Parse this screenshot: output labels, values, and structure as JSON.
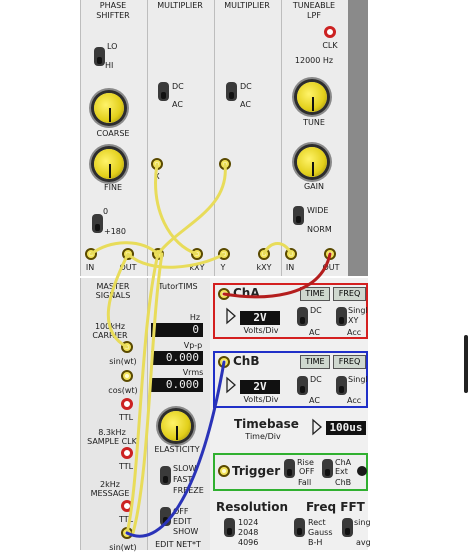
{
  "modules": {
    "phase_shifter": {
      "title_line1": "PHASE",
      "title_line2": "SHIFTER",
      "lo": "LO",
      "hi": "HI",
      "coarse": "COARSE",
      "fine": "FINE",
      "deg0": "0",
      "deg180": "+180",
      "in": "IN",
      "out": "OUT"
    },
    "multiplier1": {
      "title": "MULTIPLIER",
      "dc": "DC",
      "ac": "AC",
      "x": "X",
      "kxy": "kXY",
      "y": "Y"
    },
    "multiplier2": {
      "title": "MULTIPLIER",
      "dc": "DC",
      "ac": "AC",
      "kxy": "kXY"
    },
    "tuneable_lpf": {
      "title_line1": "TUNEABLE",
      "title_line2": "LPF",
      "clk": "CLK",
      "freq": "12000 Hz",
      "tune": "TUNE",
      "gain": "GAIN",
      "wide": "WIDE",
      "norm": "NORM",
      "in": "IN",
      "out": "OUT"
    },
    "master_signals": {
      "title_line1": "MASTER",
      "title_line2": "SIGNALS",
      "carrier_line1": "100kHz",
      "carrier_line2": "CARRIER",
      "sin_wt": "sin(wt)",
      "cos_wt": "cos(wt)",
      "ttl": "TTL",
      "sample_clk_line1": "8.3kHz",
      "sample_clk_line2": "SAMPLE CLK",
      "ttl2": "TTL",
      "msg_line1": "2kHz",
      "msg_line2": "MESSAGE",
      "ttl3": "TTL",
      "sin_wt2": "sin(wt)"
    },
    "tutortims": {
      "title": "TutorTIMS",
      "hz_label": "Hz",
      "hz_value": "0",
      "vpp_label": "Vp-p",
      "vpp_value": "0.000",
      "vrms_label": "Vrms",
      "vrms_value": "0.000",
      "elasticity": "ELASTICITY",
      "slow": "SLOW",
      "fast": "FAST",
      "freeze": "FREEZE",
      "off": "OFF",
      "edit": "EDIT",
      "show": "SHOW",
      "footer": "EDIT NET*T"
    }
  },
  "scope": {
    "cha": {
      "title": "ChA",
      "time_btn": "TIME",
      "freq_btn": "FREQ",
      "volts": "2V",
      "volts_div": "Volts/Div",
      "dc": "DC",
      "ac": "AC",
      "singl": "Singl",
      "xy": "XY",
      "acc": "Acc",
      "color": "#d42020"
    },
    "chb": {
      "title": "ChB",
      "time_btn": "TIME",
      "freq_btn": "FREQ",
      "volts": "2V",
      "volts_div": "Volts/Div",
      "dc": "DC",
      "ac": "AC",
      "singl": "Singl",
      "acc": "Acc",
      "color": "#2030c8"
    },
    "timebase": {
      "title": "Timebase",
      "sub": "Time/Div",
      "value": "100us"
    },
    "trigger": {
      "title": "Trigger",
      "rise": "Rise",
      "off": "OFF",
      "fall": "Fall",
      "cha": "ChA",
      "ext": "Ext",
      "chb": "ChB",
      "color": "#30b030"
    },
    "resolution": {
      "title": "Resolution",
      "opt1": "1024",
      "opt2": "2048",
      "opt3": "4096"
    },
    "freq_fft": {
      "title": "Freq FFT",
      "rect": "Rect",
      "gauss": "Gauss",
      "bh": "B-H",
      "sing": "sing",
      "avg": "avg"
    }
  },
  "wire_colors": {
    "yellow": "#e8dc5a",
    "red": "#b41e1e",
    "blue": "#2a33b8"
  }
}
